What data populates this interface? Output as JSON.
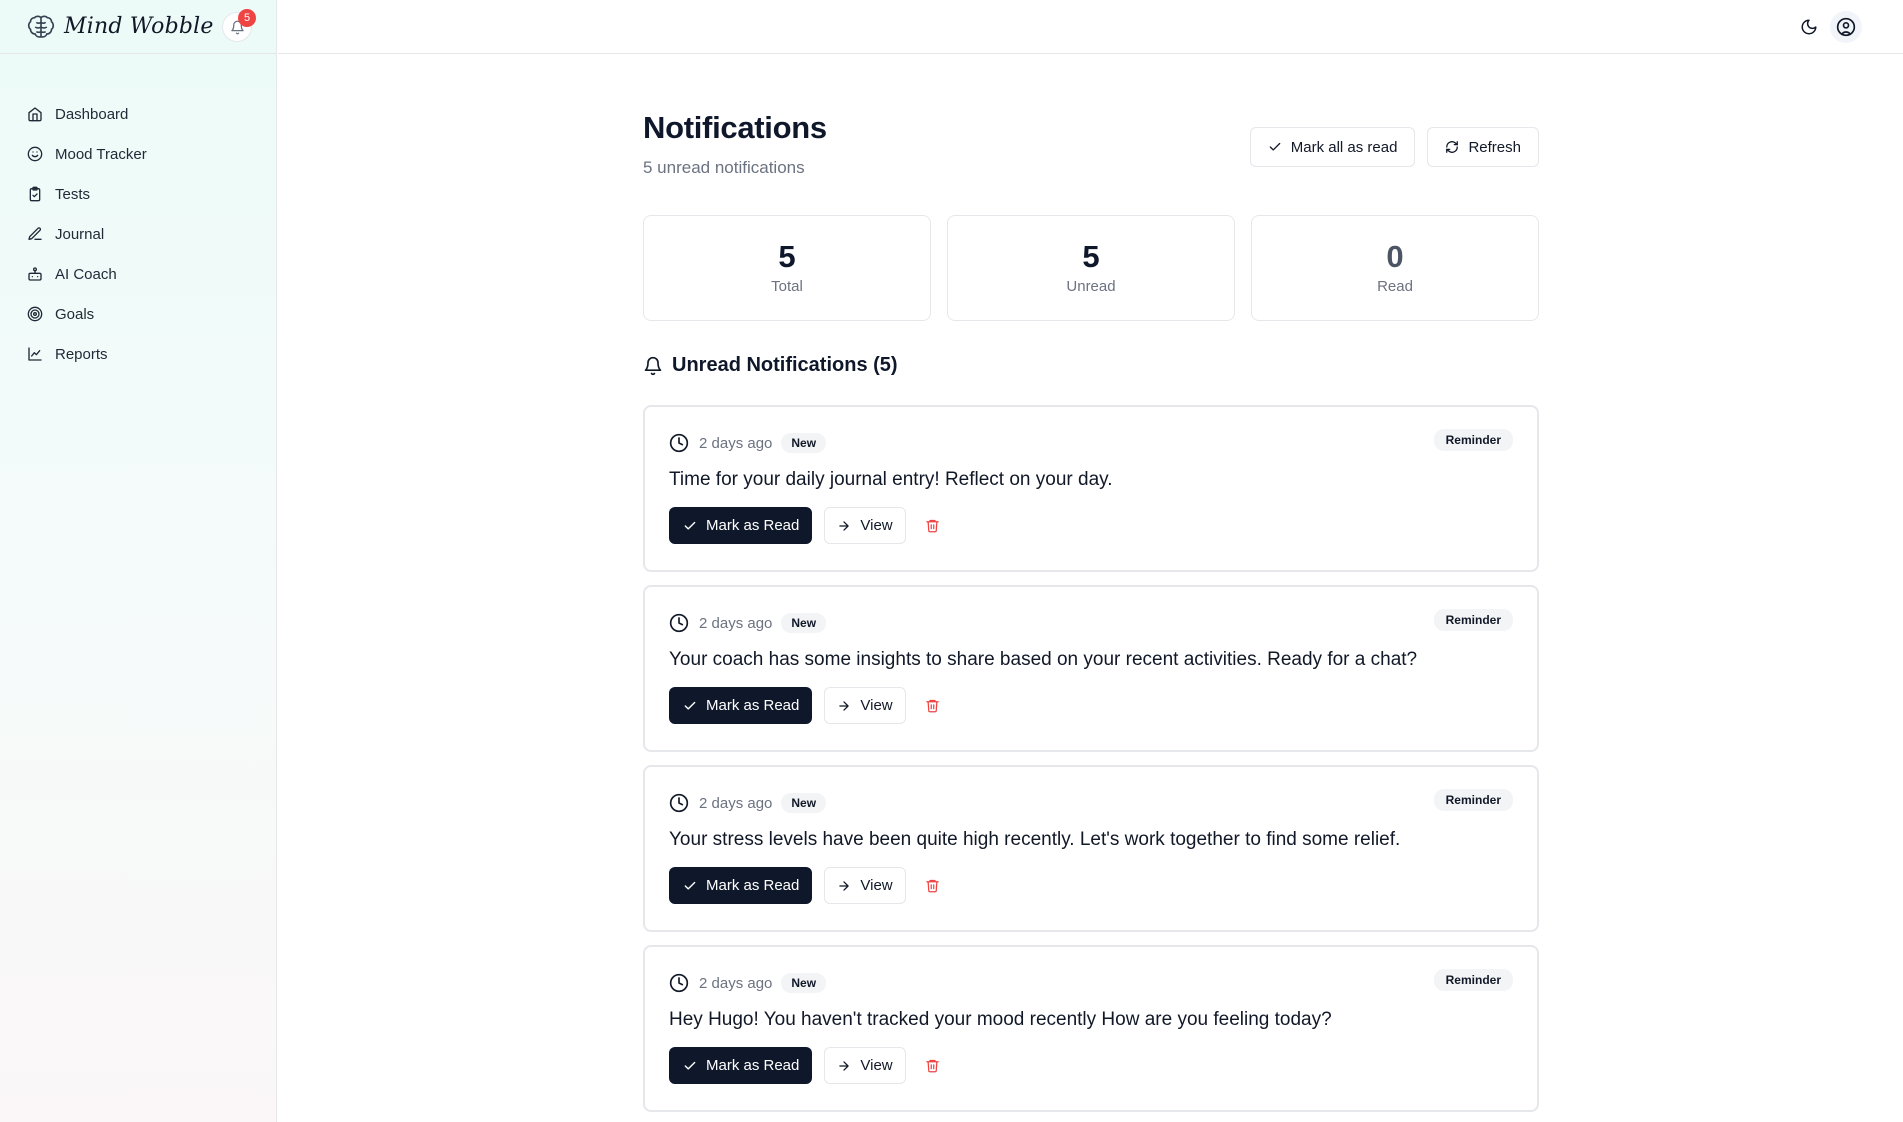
{
  "app": {
    "name": "Mind Wobble",
    "notification_count": "5"
  },
  "sidebar": {
    "items": [
      {
        "label": "Dashboard",
        "icon": "home-icon"
      },
      {
        "label": "Mood Tracker",
        "icon": "smile-icon"
      },
      {
        "label": "Tests",
        "icon": "clipboard-icon"
      },
      {
        "label": "Journal",
        "icon": "pen-icon"
      },
      {
        "label": "AI Coach",
        "icon": "bot-icon"
      },
      {
        "label": "Goals",
        "icon": "target-icon"
      },
      {
        "label": "Reports",
        "icon": "line-chart-icon"
      }
    ]
  },
  "header": {
    "icons": [
      "moon-icon",
      "user-circle-icon"
    ]
  },
  "page": {
    "title": "Notifications",
    "subtitle": "5 unread notifications",
    "mark_all_label": "Mark all as read",
    "refresh_label": "Refresh"
  },
  "stats": [
    {
      "value": "5",
      "label": "Total"
    },
    {
      "value": "5",
      "label": "Unread"
    },
    {
      "value": "0",
      "label": "Read"
    }
  ],
  "section": {
    "title": "Unread Notifications (5)"
  },
  "notifications": [
    {
      "time": "2 days ago",
      "badge": "New",
      "type": "Reminder",
      "message": "Time for your daily journal entry! Reflect on your day.",
      "mark_label": "Mark as Read",
      "view_label": "View"
    },
    {
      "time": "2 days ago",
      "badge": "New",
      "type": "Reminder",
      "message": "Your coach has some insights to share based on your recent activities. Ready for a chat?",
      "mark_label": "Mark as Read",
      "view_label": "View"
    },
    {
      "time": "2 days ago",
      "badge": "New",
      "type": "Reminder",
      "message": "Your stress levels have been quite high recently. Let's work together to find some relief.",
      "mark_label": "Mark as Read",
      "view_label": "View"
    },
    {
      "time": "2 days ago",
      "badge": "New",
      "type": "Reminder",
      "message": "Hey Hugo! You haven't tracked your mood recently How are you feeling today?",
      "mark_label": "Mark as Read",
      "view_label": "View"
    }
  ],
  "colors": {
    "accent_dark": "#0f172a",
    "badge_red": "#ef4444",
    "delete_red": "#ef4444"
  }
}
